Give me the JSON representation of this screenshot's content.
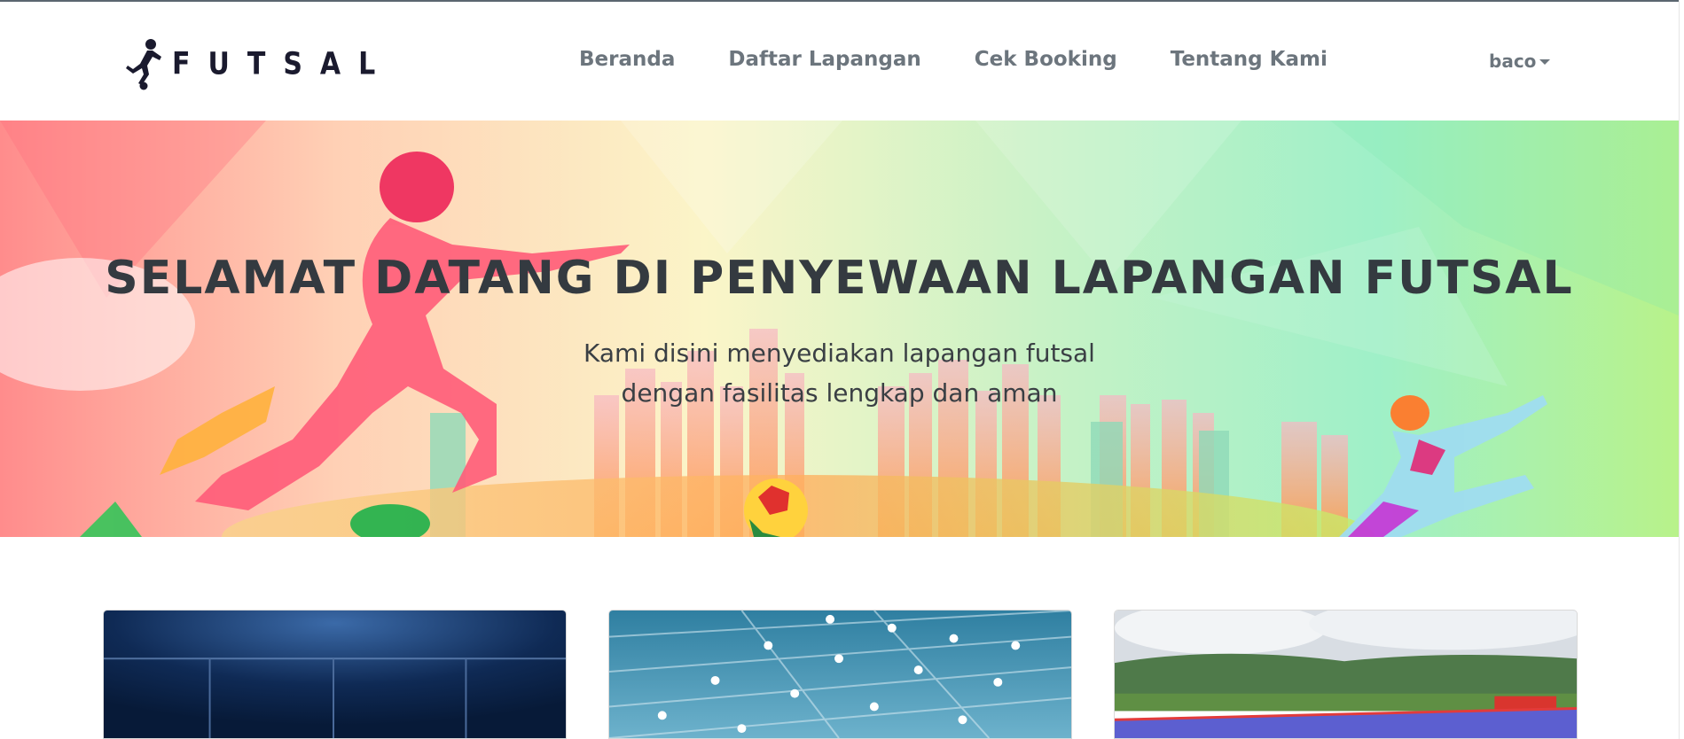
{
  "navbar": {
    "brand": "FUTSAL",
    "links": [
      {
        "label": "Beranda"
      },
      {
        "label": "Daftar Lapangan"
      },
      {
        "label": "Cek Booking"
      },
      {
        "label": "Tentang Kami"
      }
    ],
    "user": "baco"
  },
  "hero": {
    "title": "SELAMAT DATANG DI PENYEWAAN LAPANGAN FUTSAL",
    "subtitle_line1": "Kami disini menyediakan lapangan futsal",
    "subtitle_line2": "dengan fasilitas lengkap dan aman"
  },
  "cards": [
    {
      "icon": "field-photo-night"
    },
    {
      "icon": "field-photo-indoor"
    },
    {
      "icon": "field-photo-outdoor"
    }
  ],
  "colors": {
    "text_dark": "#343a40",
    "nav_text": "#6c757d",
    "brand": "#1a1a2e"
  }
}
